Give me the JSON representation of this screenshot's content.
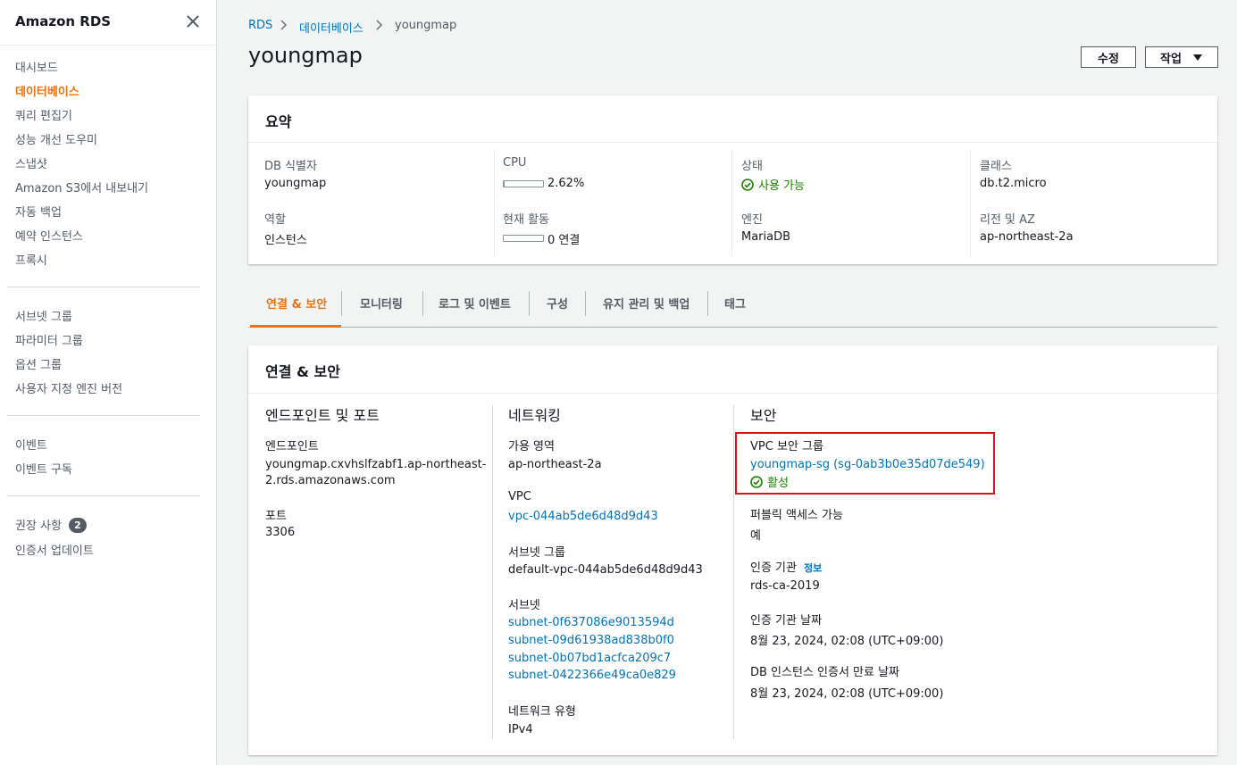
{
  "sidebar": {
    "title": "Amazon RDS",
    "group1": [
      "대시보드",
      "데이터베이스",
      "쿼리 편집기",
      "성능 개선 도우미",
      "스냅샷",
      "Amazon S3에서 내보내기",
      "자동 백업",
      "예약 인스턴스",
      "프록시"
    ],
    "group2": [
      "서브넷 그룹",
      "파라미터 그룹",
      "옵션 그룹",
      "사용자 지정 엔진 버전"
    ],
    "group3": [
      "이벤트",
      "이벤트 구독"
    ],
    "group4": [
      "권장 사항",
      "인증서 업데이트"
    ],
    "recommend_count": "2"
  },
  "breadcrumb": [
    "RDS",
    "데이터베이스",
    "youngmap"
  ],
  "page_title": "youngmap",
  "buttons": {
    "modify": "수정",
    "actions": "작업"
  },
  "summary": {
    "title": "요약",
    "db_id_label": "DB 식별자",
    "db_id": "youngmap",
    "cpu_label": "CPU",
    "cpu": "2.62%",
    "cpu_fraction": 0.0262,
    "status_label": "상태",
    "status": "사용 가능",
    "class_label": "클래스",
    "class": "db.t2.micro",
    "role_label": "역할",
    "role": "인스턴스",
    "activity_label": "현재 활동",
    "activity": "0 연결",
    "activity_fraction": 0,
    "engine_label": "엔진",
    "engine": "MariaDB",
    "region_label": "리전 및 AZ",
    "region": "ap-northeast-2a"
  },
  "tabs": [
    "연결 & 보안",
    "모니터링",
    "로그 및 이벤트",
    "구성",
    "유지 관리 및 백업",
    "태그"
  ],
  "conn": {
    "title": "연결 & 보안",
    "endpoint_section": "엔드포인트 및 포트",
    "endpoint_label": "엔드포인트",
    "endpoint_line1": "youngmap.cxvhslfzabf1.ap-northeast-",
    "endpoint_line2": "2.rds.amazonaws.com",
    "port_label": "포트",
    "port": "3306",
    "network_section": "네트워킹",
    "az_label": "가용 영역",
    "az": "ap-northeast-2a",
    "vpc_label": "VPC",
    "vpc": "vpc-044ab5de6d48d9d43",
    "subnet_group_label": "서브넷 그룹",
    "subnet_group": "default-vpc-044ab5de6d48d9d43",
    "subnets_label": "서브넷",
    "subnets": [
      "subnet-0f637086e9013594d",
      "subnet-09d61938ad838b0f0",
      "subnet-0b07bd1acfca209c7",
      "subnet-0422366e49ca0e829"
    ],
    "net_type_label": "네트워크 유형",
    "net_type": "IPv4",
    "security_section": "보안",
    "sg_label": "VPC 보안 그룹",
    "sg": "youngmap-sg (sg-0ab3b0e35d07de549)",
    "sg_status": "활성",
    "public_label": "퍼블릭 액세스 가능",
    "public": "예",
    "ca_label": "인증 기관",
    "ca_info": "정보",
    "ca": "rds-ca-2019",
    "ca_date_label": "인증 기관 날짜",
    "ca_date": "8월 23, 2024, 02:08 (UTC+09:00)",
    "cert_exp_label": "DB 인스턴스 인증서 만료 날짜",
    "cert_exp": "8월 23, 2024, 02:08 (UTC+09:00)"
  },
  "colors": {
    "accent": "#ec7211",
    "link": "#0073bb",
    "success": "#1d8102",
    "highlight": "#d91515"
  }
}
